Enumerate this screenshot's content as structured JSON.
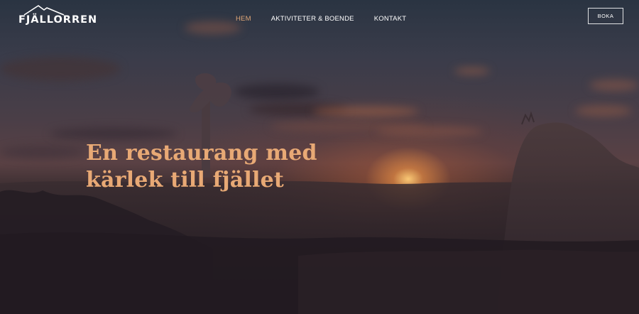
{
  "brand": {
    "name": "FJÄLLORREN",
    "logo_icon": "mountain-icon"
  },
  "nav": {
    "items": [
      {
        "label": "HEM",
        "active": true
      },
      {
        "label": "AKTIVITETER & BOENDE",
        "active": false
      },
      {
        "label": "KONTAKT",
        "active": false
      }
    ],
    "book_label": "BOKA"
  },
  "hero": {
    "headline_line1": "En restaurang med",
    "headline_line2": "kärlek till fjället"
  },
  "colors": {
    "accent": "#e0a777",
    "headline": "#e8a975",
    "nav_text": "#ffffff"
  }
}
